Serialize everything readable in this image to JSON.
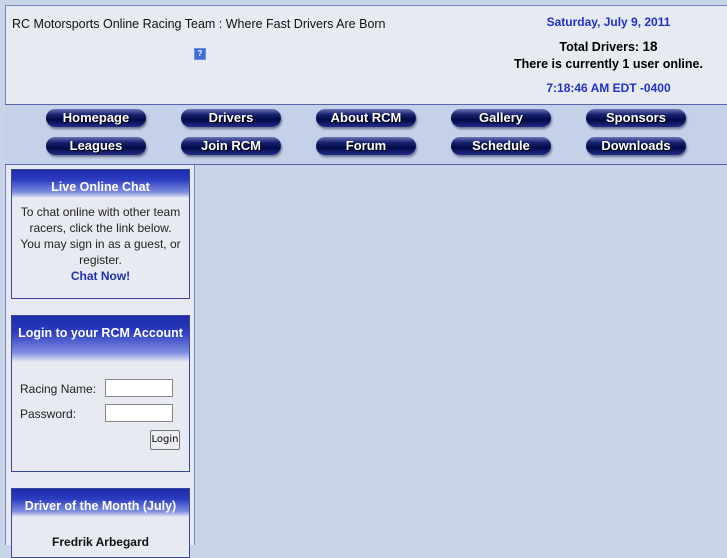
{
  "header": {
    "site_title": "RC Motorsports Online Racing Team : Where Fast Drivers Are Born",
    "help_icon": "question-icon",
    "date": "Saturday, July 9, 2011",
    "total_drivers_label": "Total Drivers:",
    "total_drivers_value": "18",
    "users_online": "There is currently 1 user online.",
    "time": "7:18:46 AM EDT -0400"
  },
  "nav": {
    "row1": [
      "Homepage",
      "Drivers",
      "About RCM",
      "Gallery",
      "Sponsors"
    ],
    "row2": [
      "Leagues",
      "Join RCM",
      "Forum",
      "Schedule",
      "Downloads"
    ]
  },
  "chat_panel": {
    "title": "Live Online Chat",
    "text": "To chat online with other team racers, click the link below. You may sign in as a guest, or register.",
    "link": "Chat Now!"
  },
  "login_panel": {
    "title": "Login to your RCM Account",
    "racing_name_label": "Racing Name:",
    "password_label": "Password:",
    "button": "Login"
  },
  "dotm_panel": {
    "title": "Driver of the Month (July)",
    "name": "Fredrik Arbegard"
  }
}
